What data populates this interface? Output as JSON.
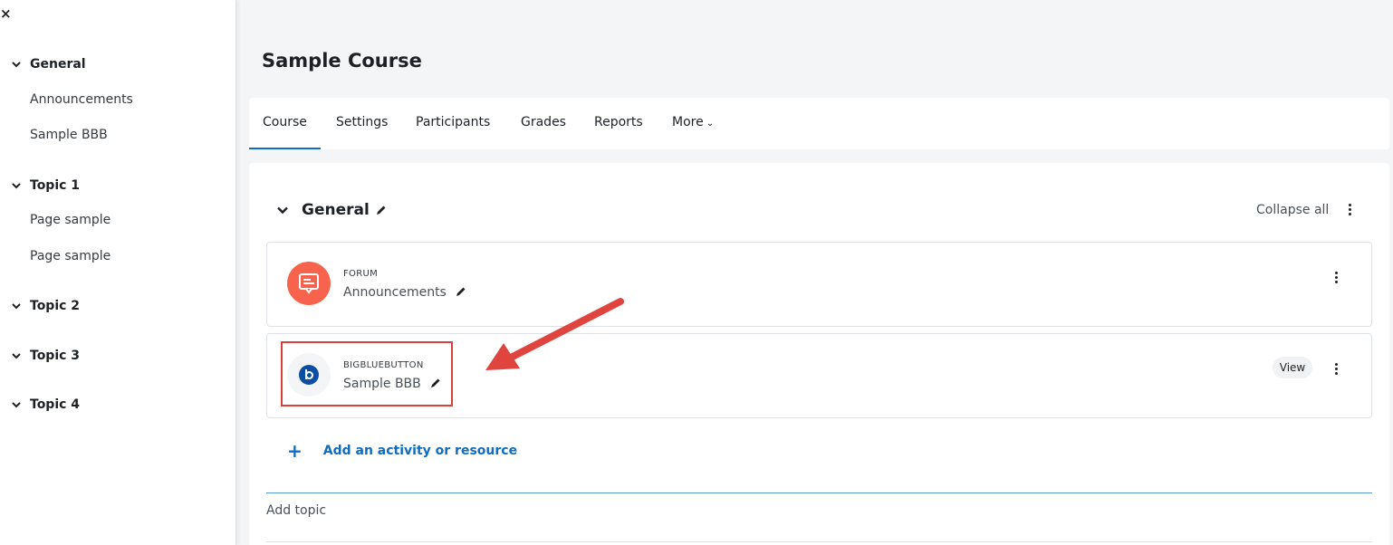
{
  "sidebar": {
    "close_icon": "×",
    "sections": [
      {
        "label": "General",
        "items": [
          "Announcements",
          "Sample BBB"
        ]
      },
      {
        "label": "Topic 1",
        "items": [
          "Page sample",
          "Page sample"
        ]
      },
      {
        "label": "Topic 2",
        "items": []
      },
      {
        "label": "Topic 3",
        "items": []
      },
      {
        "label": "Topic 4",
        "items": []
      }
    ]
  },
  "page": {
    "title": "Sample Course"
  },
  "tabs": [
    {
      "label": "Course",
      "active": true
    },
    {
      "label": "Settings"
    },
    {
      "label": "Participants"
    },
    {
      "label": "Grades"
    },
    {
      "label": "Reports"
    },
    {
      "label": "More"
    }
  ],
  "more_caret": "⌄",
  "section": {
    "title": "General",
    "collapse_all": "Collapse all"
  },
  "activities": [
    {
      "type": "FORUM",
      "name": "Announcements",
      "icon": "forum-icon",
      "color": "#f7634d"
    },
    {
      "type": "BIGBLUEBUTTON",
      "name": "Sample BBB",
      "icon": "bigbluebutton-icon",
      "color": "#0b4ea2",
      "view_label": "View"
    }
  ],
  "add_activity": {
    "plus": "+",
    "label": "Add an activity or resource"
  },
  "add_topic": "Add topic",
  "colors": {
    "accent": "#0f6cbf",
    "highlight": "#d9403a"
  }
}
